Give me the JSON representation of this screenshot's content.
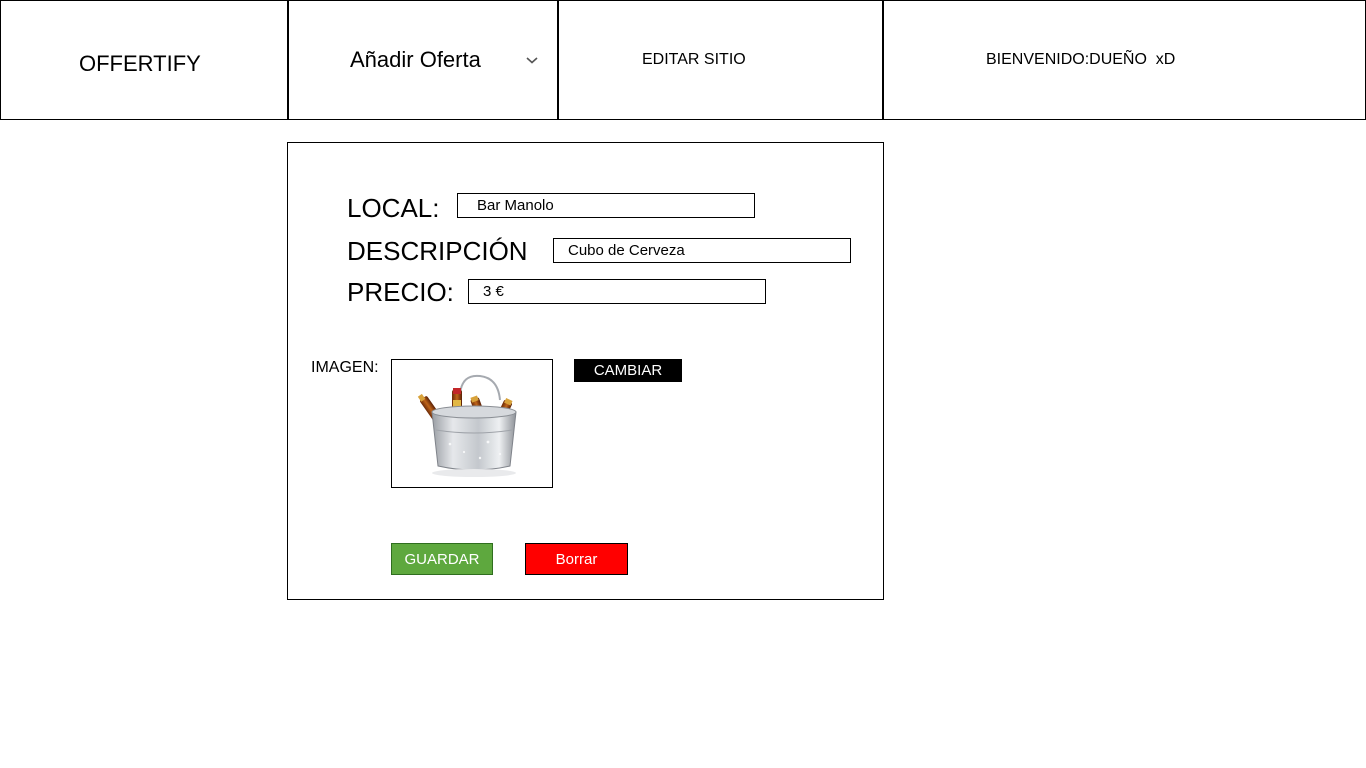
{
  "header": {
    "logo": "OFFERTIFY",
    "menu": {
      "label": "Añadir Oferta",
      "chevron_icon": "chevron-down-icon"
    },
    "edit_site": "EDITAR SITIO",
    "welcome": "BIENVENIDO:DUEÑO  xD"
  },
  "form": {
    "local": {
      "label": "LOCAL:",
      "value": "Bar Manolo"
    },
    "descripcion": {
      "label": "DESCRIPCIÓN",
      "value": "Cubo de Cerveza"
    },
    "precio": {
      "label": "PRECIO:",
      "value": "3 €"
    },
    "imagen": {
      "label": "IMAGEN:",
      "image_icon": "beer-bucket-image"
    },
    "buttons": {
      "cambiar": "CAMBIAR",
      "guardar": "GUARDAR",
      "borrar": "Borrar"
    }
  },
  "colors": {
    "guardar_bg": "#5ea83e",
    "borrar_bg": "#ff0000",
    "cambiar_bg": "#000000"
  }
}
